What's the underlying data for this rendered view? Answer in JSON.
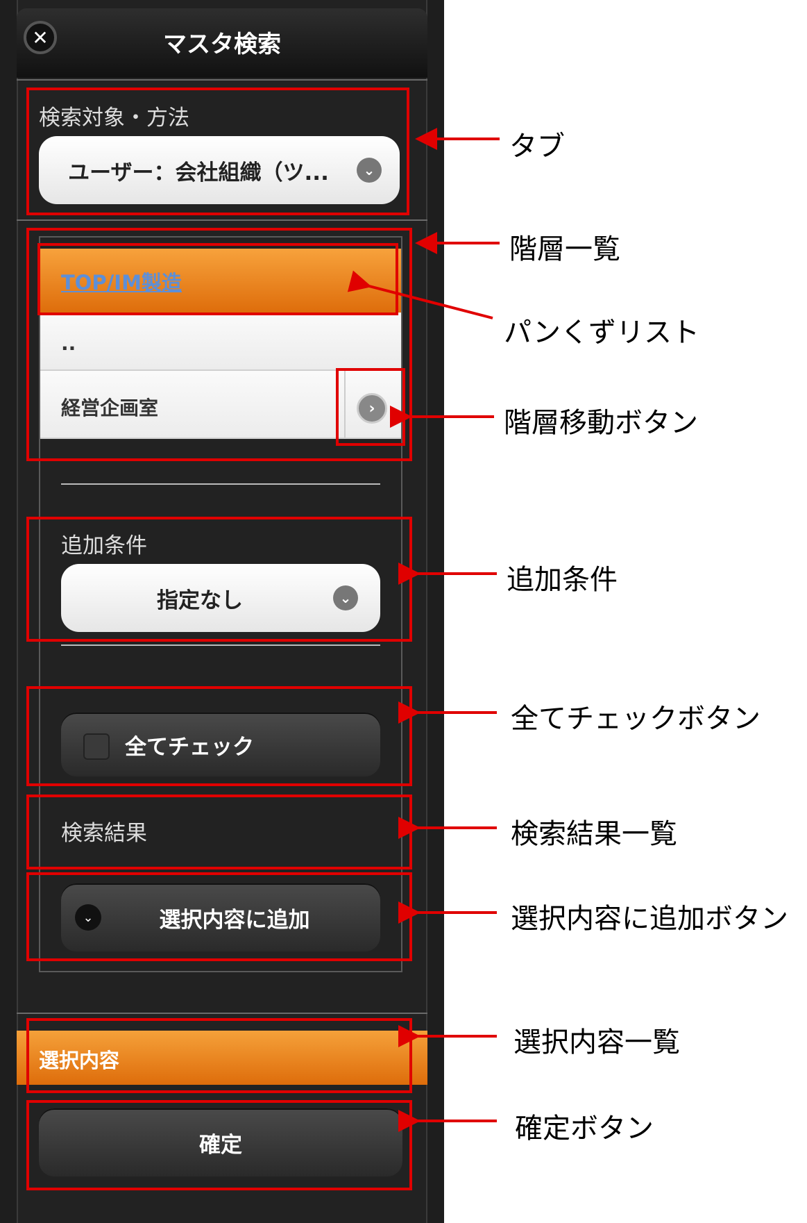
{
  "header": {
    "title": "マスタ検索",
    "close_icon": "close-icon"
  },
  "search_target": {
    "label": "検索対象・方法",
    "selected": "ユーザー：会社組織（ツ..."
  },
  "hierarchy": {
    "breadcrumb": "TOP/IM製造",
    "items": [
      "..",
      "経営企画室"
    ]
  },
  "additional_conditions": {
    "label": "追加条件",
    "selected": "指定なし"
  },
  "check_all": {
    "label": "全てチェック"
  },
  "search_results": {
    "label": "検索結果"
  },
  "add_button": {
    "label": "選択内容に追加"
  },
  "selected_list": {
    "label": "選択内容"
  },
  "confirm_button": {
    "label": "確定"
  },
  "annotations": {
    "tab": "タブ",
    "hierarchy_list": "階層一覧",
    "breadcrumb_list": "パンくずリスト",
    "hierarchy_move_button": "階層移動ボタン",
    "additional_conditions": "追加条件",
    "check_all_button": "全てチェックボタン",
    "search_result_list": "検索結果一覧",
    "add_selection_button": "選択内容に追加ボタン",
    "selection_list": "選択内容一覧",
    "confirm_button": "確定ボタン"
  },
  "colors": {
    "annotation_red": "#e00000",
    "accent_orange": "#e97b18",
    "background_dark": "#222222"
  }
}
